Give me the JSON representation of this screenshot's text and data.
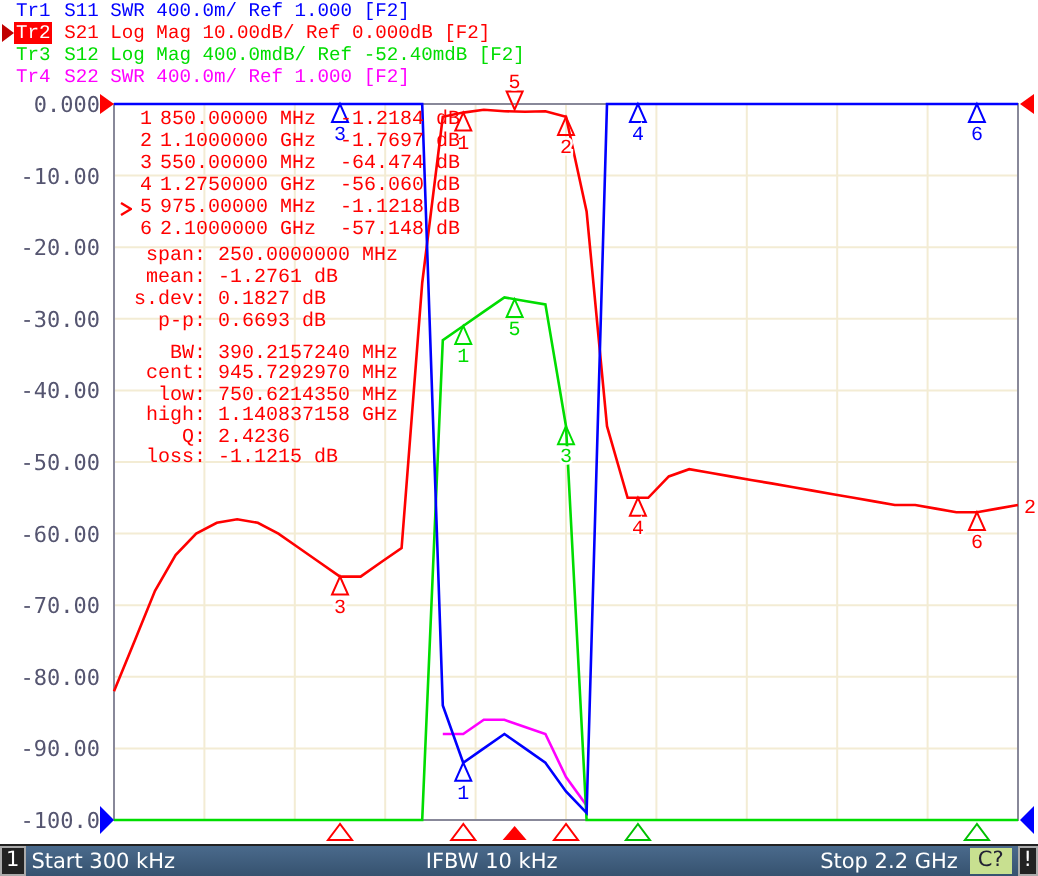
{
  "traces": [
    {
      "id": "Tr1",
      "settings": "SWR 400.0m/ Ref 1.000 [F2]",
      "color": "#0000ff",
      "selected": false,
      "markers": [
        "3",
        "4",
        "6",
        "1"
      ]
    },
    {
      "id": "Tr2",
      "settings": "Log Mag 10.00dB/ Ref 0.000dB [F2]",
      "color": "#ff0000",
      "selected": true,
      "markers": [
        "1",
        "2",
        "3",
        "4",
        "5",
        "6"
      ]
    },
    {
      "id": "Tr3",
      "settings": "Log Mag 400.0mdB/ Ref -52.40mdB [F2]",
      "color": "#00dd00",
      "selected": false,
      "markers": [
        "1",
        "5",
        "3"
      ]
    },
    {
      "id": "Tr4",
      "settings": "SWR 400.0m/ Ref 1.000 [F2]",
      "color": "#ff00ff",
      "selected": false
    }
  ],
  "markers": [
    {
      "number": "1",
      "frequency": "850.00000 MHz",
      "value": "-1.2184 dB",
      "active": false
    },
    {
      "number": "2",
      "frequency": "1.1000000 GHz",
      "value": "-1.7697 dB",
      "active": false
    },
    {
      "number": "3",
      "frequency": "550.00000 MHz",
      "value": "-64.474 dB",
      "active": false
    },
    {
      "number": "4",
      "frequency": "1.2750000 GHz",
      "value": "-56.060 dB",
      "active": false
    },
    {
      "number": "5",
      "frequency": "975.00000 MHz",
      "value": "-1.1218 dB",
      "active": true
    },
    {
      "number": "6",
      "frequency": "2.1000000 GHz",
      "value": "-57.148 dB",
      "active": false
    }
  ],
  "statistics": [
    {
      "label": "span:",
      "value": "250.0000000 MHz"
    },
    {
      "label": "mean:",
      "value": "-1.2761 dB"
    },
    {
      "label": "s.dev:",
      "value": "0.1827 dB"
    },
    {
      "label": "p-p:",
      "value": "0.6693 dB"
    }
  ],
  "bandwidth": [
    {
      "label": "BW:",
      "value": "390.2157240 MHz"
    },
    {
      "label": "cent:",
      "value": "945.7292970 MHz"
    },
    {
      "label": "low:",
      "value": "750.6214350 MHz"
    },
    {
      "label": "high:",
      "value": "1.140837158 GHz"
    },
    {
      "label": "Q:",
      "value": "2.4236"
    },
    {
      "label": "loss:",
      "value": "-1.1215 dB"
    }
  ],
  "trace_end_label": "2",
  "chart_data": {
    "type": "line",
    "grid": true,
    "ylim": [
      -100,
      0
    ],
    "yticks": [
      {
        "value": 0,
        "label": "0.000"
      },
      {
        "value": -10,
        "label": "-10.00"
      },
      {
        "value": -20,
        "label": "-20.00"
      },
      {
        "value": -30,
        "label": "-30.00"
      },
      {
        "value": -40,
        "label": "-40.00"
      },
      {
        "value": -50,
        "label": "-50.00"
      },
      {
        "value": -60,
        "label": "-60.00"
      },
      {
        "value": -70,
        "label": "-70.00"
      },
      {
        "value": -80,
        "label": "-80.00"
      },
      {
        "value": -90,
        "label": "-90.00"
      },
      {
        "value": -100,
        "label": "-100.0"
      }
    ],
    "categories": [
      null,
      null,
      null,
      null,
      null,
      null,
      null,
      null,
      null,
      null,
      null,
      null,
      null,
      null,
      null,
      null,
      null,
      null,
      null,
      null,
      null,
      null,
      null,
      null,
      null,
      null,
      null,
      null,
      null,
      null,
      null,
      null,
      null,
      null,
      null,
      null,
      null,
      null,
      null,
      null,
      null,
      null,
      null,
      null,
      null
    ],
    "series": [
      {
        "name": "S11",
        "color": "#0000ff",
        "values": [
          0,
          0,
          0,
          0,
          0,
          0,
          0,
          0,
          0,
          0,
          0,
          0,
          0,
          0,
          0,
          0,
          -84,
          -92,
          -90,
          -88,
          -90,
          -92,
          -96,
          -99,
          0,
          0,
          0,
          0,
          0,
          0,
          0,
          0,
          0,
          0,
          0,
          0,
          0,
          0,
          0,
          0,
          0,
          0,
          0,
          0,
          0
        ]
      },
      {
        "name": "S21",
        "color": "#ff0000",
        "values": [
          -82,
          -75,
          -68,
          -63,
          -60,
          -58.5,
          -58,
          -58.5,
          -60,
          -62,
          -64,
          -66,
          -66,
          -64,
          -62,
          -25,
          -1.8,
          -1.2,
          -0.8,
          -1.0,
          -1.1,
          -1.0,
          -1.8,
          -15,
          -45,
          -55,
          -55,
          -52,
          -51,
          -51.5,
          -52,
          -52.5,
          -53,
          -53.5,
          -54,
          -54.5,
          -55,
          -55.5,
          -56,
          -56,
          -56.5,
          -57,
          -57,
          -56.5,
          -56
        ]
      },
      {
        "name": "S12",
        "color": "#00dd00",
        "values": [
          -100,
          -100,
          -100,
          -100,
          -100,
          -100,
          -100,
          -100,
          -100,
          -100,
          -100,
          -100,
          -100,
          -100,
          -100,
          -100,
          -33,
          -31,
          -29,
          -27,
          -27.5,
          -28,
          -45,
          -100,
          -100,
          -100,
          -100,
          -100,
          -100,
          -100,
          -100,
          -100,
          -100,
          -100,
          -100,
          -100,
          -100,
          -100,
          -100,
          -100,
          -100,
          -100,
          -100,
          -100,
          -100
        ]
      },
      {
        "name": "S22",
        "color": "#ff00ff",
        "values": [
          null,
          null,
          null,
          null,
          null,
          null,
          null,
          null,
          null,
          null,
          null,
          null,
          null,
          null,
          null,
          null,
          -88,
          -88,
          -86,
          -86,
          -87,
          -88,
          -94,
          -98,
          null,
          null,
          null,
          null,
          null,
          null,
          null,
          null,
          null,
          null,
          null,
          null,
          null,
          null,
          null,
          null,
          null,
          null,
          null,
          null,
          null
        ]
      }
    ]
  },
  "status_bar": {
    "channel": "1",
    "start": "Start 300 kHz",
    "ifbw": "IFBW 10 kHz",
    "stop": "Stop 2.2 GHz",
    "calibration": "C?",
    "alert": "!"
  }
}
